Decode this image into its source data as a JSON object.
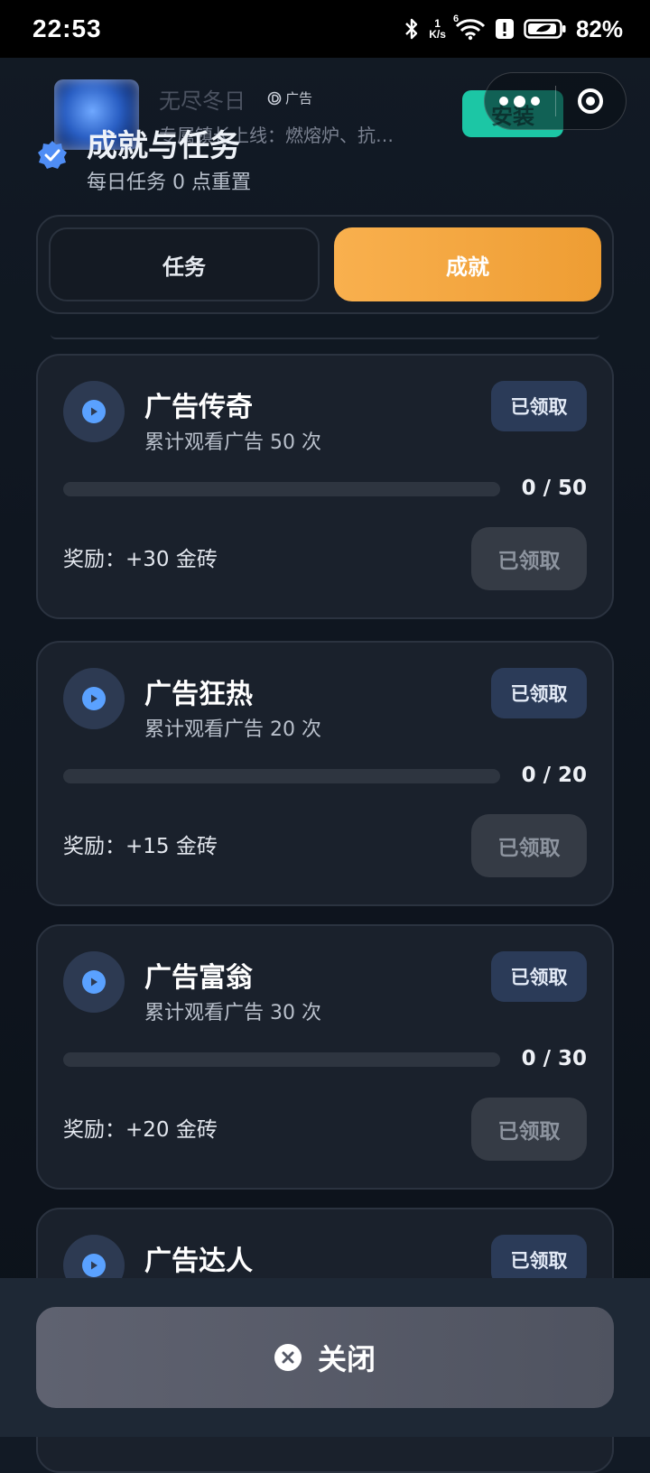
{
  "status_bar": {
    "time": "22:53",
    "net_speed_value": "1",
    "net_speed_unit": "K/s",
    "wifi_badge": "6",
    "battery": "82%"
  },
  "ad": {
    "title": "无尽冬日",
    "label": "广告",
    "desc": "专属镇长上线：燃熔炉、抗…",
    "install": "安装"
  },
  "header": {
    "title": "成就与任务",
    "subtitle": "每日任务 0 点重置"
  },
  "tabs": [
    {
      "label": "任务",
      "active": false
    },
    {
      "label": "成就",
      "active": true
    }
  ],
  "tasks": [
    {
      "title": "广告传奇",
      "desc": "累计观看广告 50 次",
      "badge": "已领取",
      "progress_text": "0 / 50",
      "progress": 0,
      "reward": "奖励：+30 金砖",
      "button": "已领取"
    },
    {
      "title": "广告狂热",
      "desc": "累计观看广告 20 次",
      "badge": "已领取",
      "progress_text": "0 / 20",
      "progress": 0,
      "reward": "奖励：+15 金砖",
      "button": "已领取"
    },
    {
      "title": "广告富翁",
      "desc": "累计观看广告 30 次",
      "badge": "已领取",
      "progress_text": "0 / 30",
      "progress": 0,
      "reward": "奖励：+20 金砖",
      "button": "已领取"
    },
    {
      "title": "广告达人",
      "badge": "已领取"
    }
  ],
  "footer": {
    "close_label": "关闭"
  },
  "colors": {
    "accent": "#f3a441",
    "badge_bg": "#2b3b58",
    "play_icon": "#5aa1ff",
    "install": "#1cc6a5"
  }
}
